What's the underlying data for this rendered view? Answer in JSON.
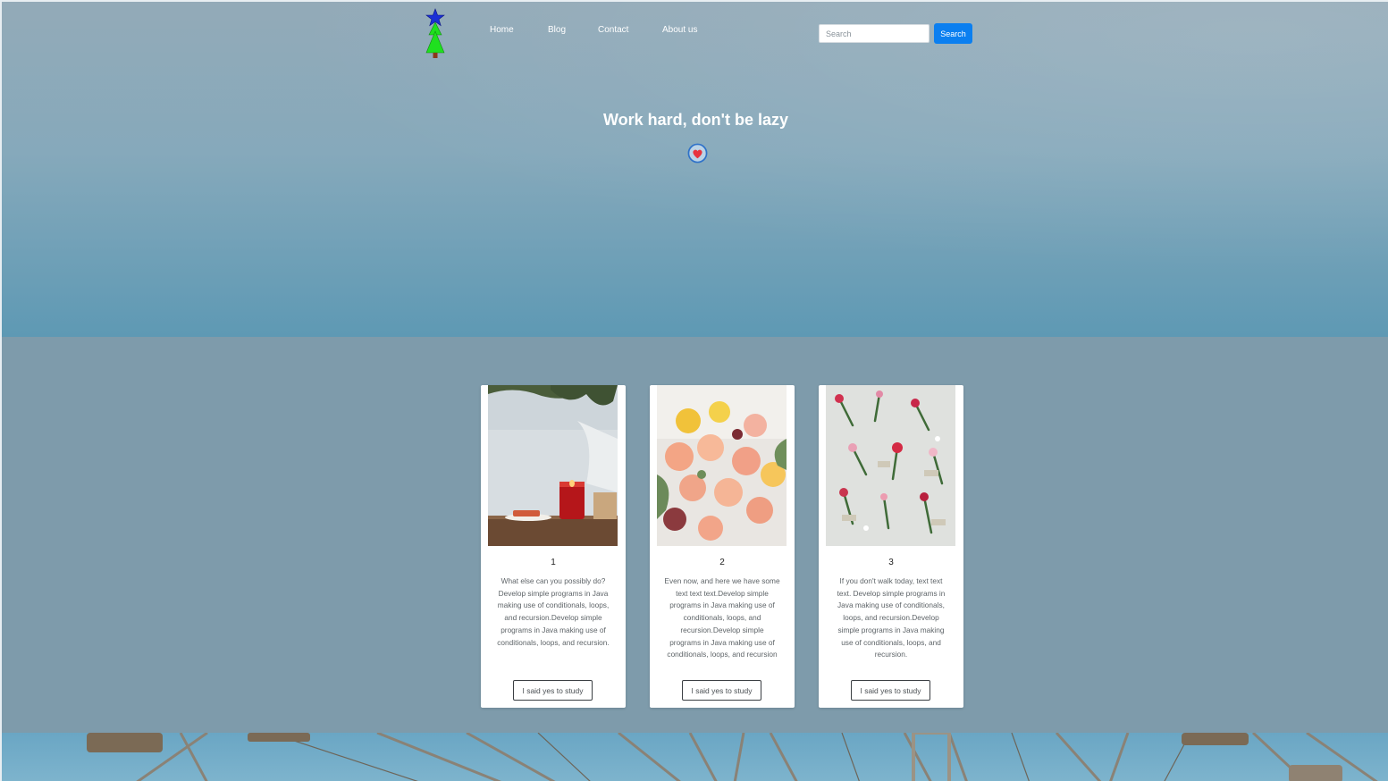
{
  "nav": {
    "links": [
      "Home",
      "Blog",
      "Contact",
      "About us"
    ]
  },
  "search": {
    "placeholder": "Search",
    "button_label": "Search"
  },
  "hero": {
    "title": "Work hard, don't be lazy"
  },
  "cards": [
    {
      "number": "1",
      "text": "What else can you possibly do?Develop simple programs in Java making use of conditionals, loops, and recursion.Develop simple programs in Java making use of conditionals, loops, and recursion.",
      "button_label": "I said yes to study"
    },
    {
      "number": "2",
      "text": "Even now, and here we have some text text text.Develop simple programs in Java making use of conditionals, loops, and recursion.Develop simple programs in Java making use of conditionals, loops, and recursion",
      "button_label": "I said yes to study"
    },
    {
      "number": "3",
      "text": "If you don't walk today, text text text. Develop simple programs in Java making use of conditionals, loops, and recursion.Develop simple programs in Java making use of conditionals, loops, and recursion.",
      "button_label": "I said yes to study"
    }
  ],
  "icons": {
    "logo": "tree-star-logo",
    "hero": "heart-icon"
  },
  "colors": {
    "accent": "#0b7ff0",
    "hero_top": "#93aab8",
    "hero_bottom": "#5e99b4",
    "section_bg": "#7e9bab"
  }
}
